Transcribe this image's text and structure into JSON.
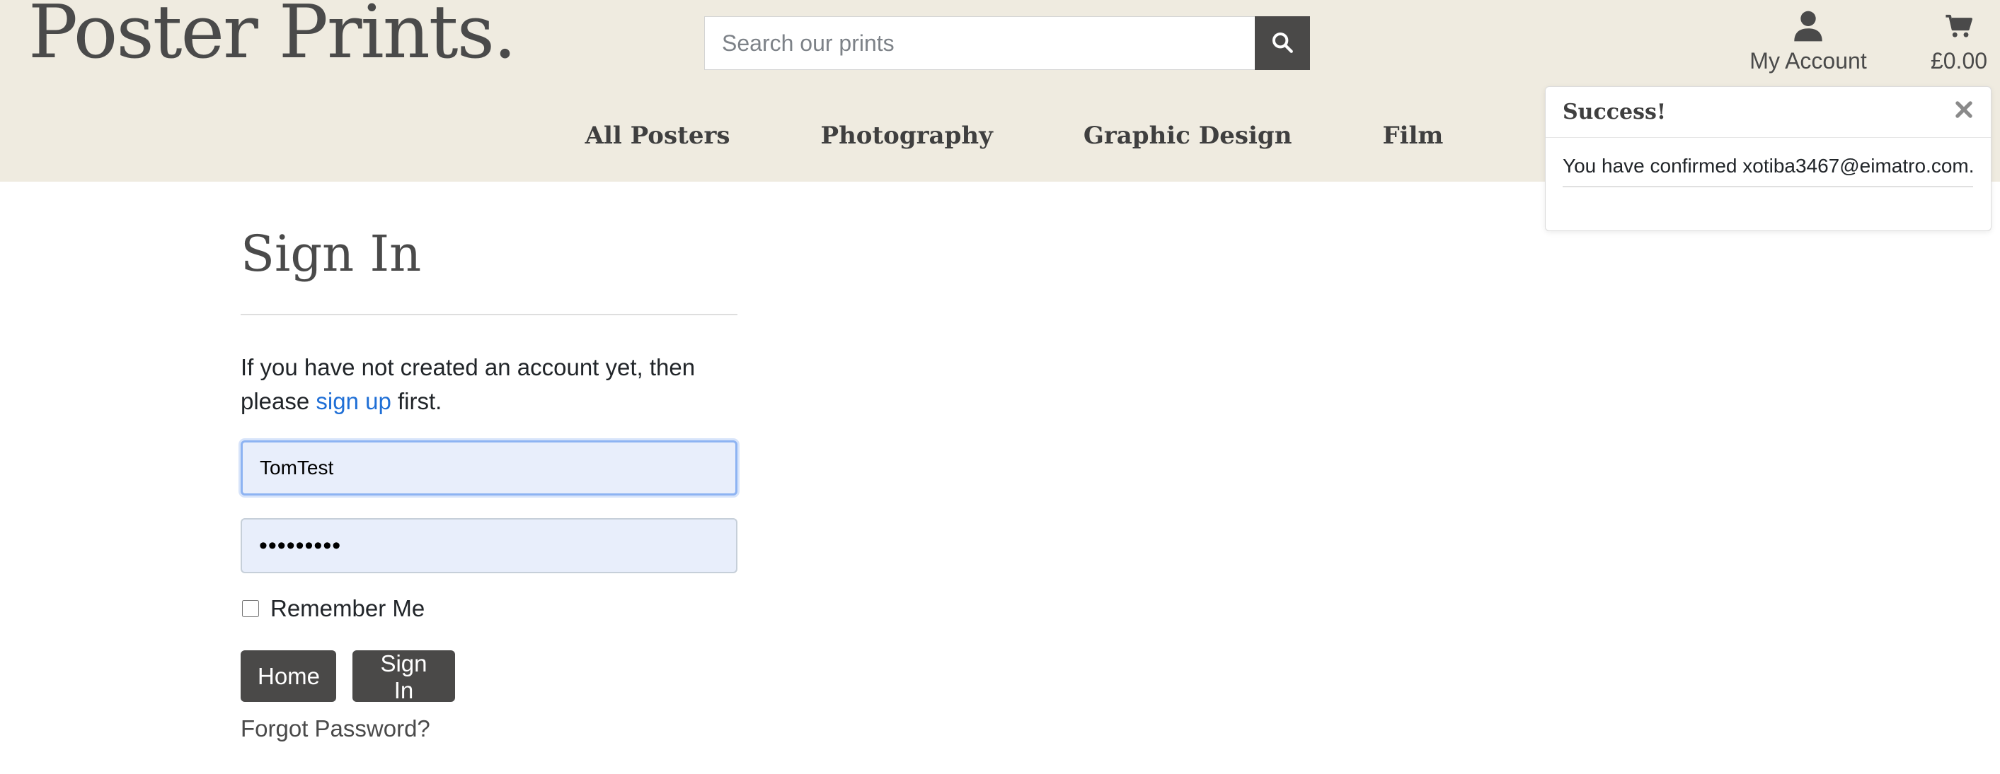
{
  "header": {
    "logo": "Poster Prints.",
    "search": {
      "placeholder": "Search our prints",
      "value": ""
    },
    "account_label": "My Account",
    "bag_total": "£0.00",
    "background_color": "#efebe0"
  },
  "nav": {
    "items": [
      {
        "label": "All Posters"
      },
      {
        "label": "Photography"
      },
      {
        "label": "Graphic Design"
      },
      {
        "label": "Film"
      }
    ]
  },
  "toast": {
    "title": "Success!",
    "message": "You have confirmed xotiba3467@eimatro.com."
  },
  "signin": {
    "title": "Sign In",
    "intro_before": "If you have not created an account yet, then please ",
    "intro_link": "sign up",
    "intro_after": " first.",
    "username_value": "TomTest",
    "password_value": "•••••••••",
    "remember_label": "Remember Me",
    "remember_checked": false,
    "home_button": "Home",
    "signin_button": "Sign In",
    "forgot_link": "Forgot Password?"
  },
  "icons": {
    "search": "search-icon",
    "account": "user-icon",
    "bag": "shopping-cart-icon",
    "close": "close-icon"
  },
  "colors": {
    "header_bg": "#efebe0",
    "button_bg": "#4a4948",
    "link": "#1f6fd6",
    "input_bg": "#e8eefb"
  }
}
